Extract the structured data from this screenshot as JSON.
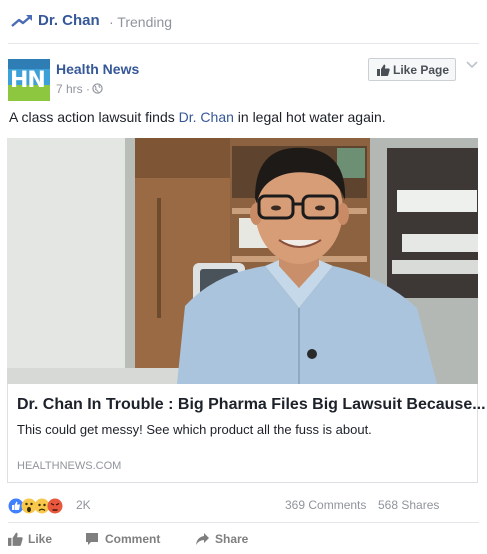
{
  "header": {
    "topic": "Dr. Chan",
    "trending_label": "· Trending",
    "icon": "trending-arrow-icon"
  },
  "post": {
    "page_name": "Health News",
    "logo_text": "HN",
    "time": "7 hrs ·",
    "privacy_icon": "globe-icon",
    "like_page_label": "Like Page",
    "caption_before": "A class action lawsuit finds ",
    "caption_mention": "Dr. Chan",
    "caption_after": " in legal hot water again."
  },
  "link": {
    "title": "Dr. Chan In Trouble : Big Pharma Files Big Lawsuit Because...",
    "description": "This could get messy! See which product all the fuss is about.",
    "domain": "HEALTHNEWS.COM"
  },
  "stats": {
    "reactions_count": "2K",
    "comments": "369 Comments",
    "shares": "568 Shares"
  },
  "actions": {
    "like": "Like",
    "comment": "Comment",
    "share": "Share"
  },
  "colors": {
    "link_blue": "#365899",
    "muted": "#90949c",
    "like_blue": "#4080ff",
    "angry_red": "#e9573f",
    "emoji_yellow": "#f7c84b"
  }
}
